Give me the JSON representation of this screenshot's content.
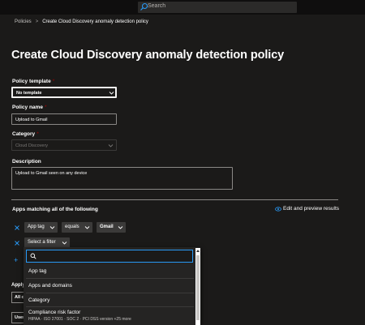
{
  "search": {
    "placeholder": "Search"
  },
  "breadcrumb": {
    "parent": "Policies",
    "separator": ">",
    "current": "Create Cloud Discovery anomaly detection policy"
  },
  "page_title": "Create Cloud Discovery anomaly detection policy",
  "form": {
    "policy_template": {
      "label": "Policy template",
      "required_mark": "*",
      "value": "No template"
    },
    "policy_name": {
      "label": "Policy name",
      "required_mark": "*",
      "value": "Upload to Gmail"
    },
    "category": {
      "label": "Category",
      "required_mark": "*",
      "value": "Cloud Discovery"
    },
    "description": {
      "label": "Description",
      "value": "Upload to Gmail seen on any device"
    }
  },
  "filters": {
    "title": "Apps matching all of the following",
    "edit_preview_label": "Edit and preview results",
    "row1": {
      "field": "App tag",
      "operator": "equals",
      "value": "Gmail"
    },
    "row2": {
      "field": "Select a filter"
    },
    "add_icon": "+"
  },
  "apply": {
    "label": "Apply",
    "box_value": "All c",
    "user_button": "User"
  },
  "filter_dropdown": {
    "search_placeholder": "",
    "items": [
      {
        "title": "App tag"
      },
      {
        "title": "Apps and domains"
      },
      {
        "title": "Category"
      },
      {
        "title": "Compliance risk factor",
        "subtitle": "HIPAA · ISO 27001 · SOC 2 · PCI DSS version +25 more"
      }
    ]
  },
  "colors": {
    "background": "#1b1a19",
    "accent": "#2899f5",
    "required": "#a80000"
  }
}
